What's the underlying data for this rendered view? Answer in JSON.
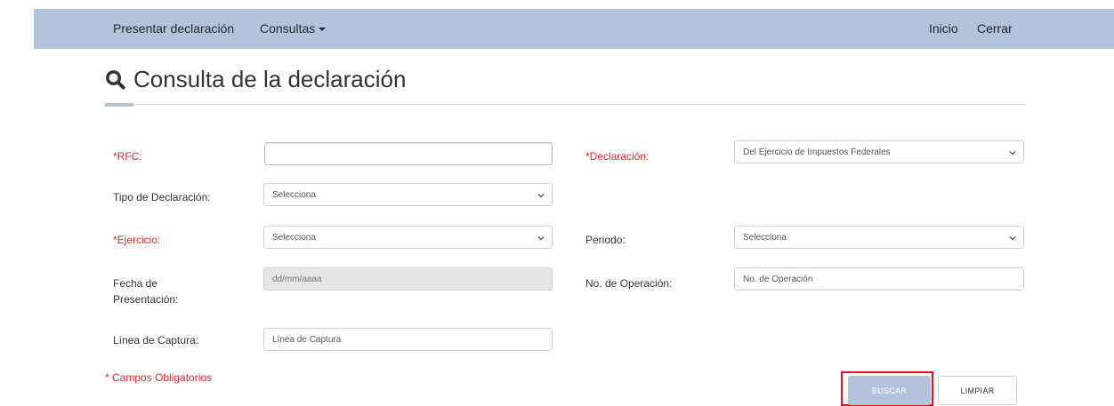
{
  "nav": {
    "presentar": "Presentar declaración",
    "consultas": "Consultas",
    "inicio": "Inicio",
    "cerrar": "Cerrar"
  },
  "page": {
    "title": "Consulta de la declaración"
  },
  "form": {
    "rfc_label": "*RFC:",
    "rfc_value": "",
    "declaracion_label": "*Declaración:",
    "declaracion_value": "Del Ejercicio de Impuestos Federales",
    "tipo_label": "Tipo de Declaración:",
    "tipo_value": "Selecciona",
    "ejercicio_label": "*Ejercicio:",
    "ejercicio_value": "Selecciona",
    "periodo_label": "Periodo:",
    "periodo_value": "Selecciona",
    "fecha_label_1": "Fecha de",
    "fecha_label_2": "Presentación:",
    "fecha_placeholder": "dd/mm/aaaa",
    "operacion_label": "No. de Operación:",
    "operacion_placeholder": "No. de Operación",
    "linea_label": "Línea de Captura:",
    "linea_placeholder": "Línea de Captura",
    "required_note": "* Campos Obligatorios"
  },
  "buttons": {
    "buscar": "BUSCAR",
    "limpiar": "LIMPIAR"
  },
  "colors": {
    "navbar": "#b3c3dc",
    "required": "#d9262d",
    "highlight": "#e0151f"
  }
}
